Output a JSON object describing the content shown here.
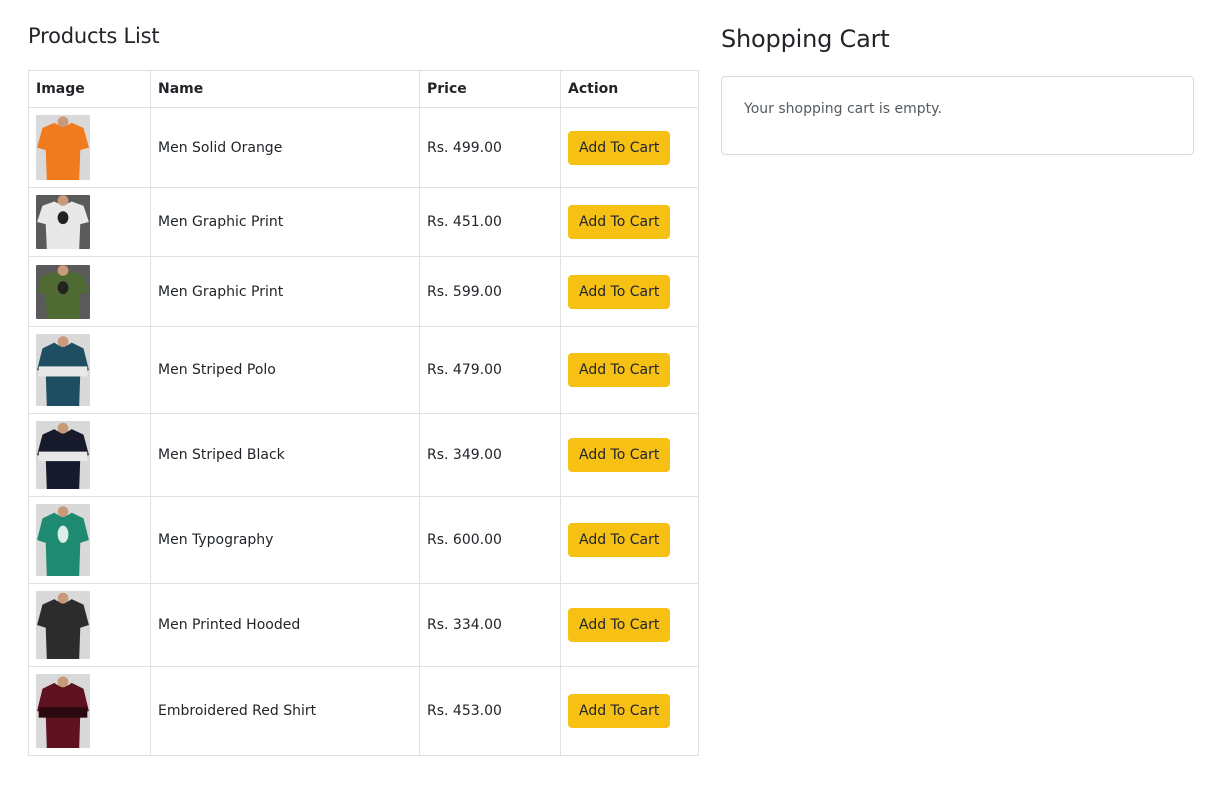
{
  "products_section": {
    "title": "Products List",
    "columns": [
      "Image",
      "Name",
      "Price",
      "Action"
    ],
    "products": [
      {
        "name": "Men Solid Orange",
        "price": "Rs. 499.00",
        "action": "Add To Cart",
        "image": "orange-polo-shirt",
        "color": "#f07a1e"
      },
      {
        "name": "Men Graphic Print",
        "price": "Rs. 451.00",
        "action": "Add To Cart",
        "image": "white-graphic-tee",
        "color": "#e8e8e8"
      },
      {
        "name": "Men Graphic Print",
        "price": "Rs. 599.00",
        "action": "Add To Cart",
        "image": "olive-graphic-tee",
        "color": "#4f6b33"
      },
      {
        "name": "Men Striped Polo",
        "price": "Rs. 479.00",
        "action": "Add To Cart",
        "image": "teal-striped-polo",
        "color": "#1f4e63"
      },
      {
        "name": "Men Striped Black",
        "price": "Rs. 349.00",
        "action": "Add To Cart",
        "image": "black-white-striped-tee",
        "color": "#171a2a"
      },
      {
        "name": "Men Typography",
        "price": "Rs. 600.00",
        "action": "Add To Cart",
        "image": "green-typography-hoodie",
        "color": "#1f8a72"
      },
      {
        "name": "Men Printed Hooded",
        "price": "Rs. 334.00",
        "action": "Add To Cart",
        "image": "black-printed-hoodie",
        "color": "#2c2c2c"
      },
      {
        "name": "Embroidered Red Shirt",
        "price": "Rs. 453.00",
        "action": "Add To Cart",
        "image": "maroon-striped-shirt",
        "color": "#5e1220"
      }
    ]
  },
  "cart": {
    "title": "Shopping Cart",
    "empty_message": "Your shopping cart is empty."
  },
  "colors": {
    "button": "#f6c015",
    "border": "#dee2e6"
  }
}
